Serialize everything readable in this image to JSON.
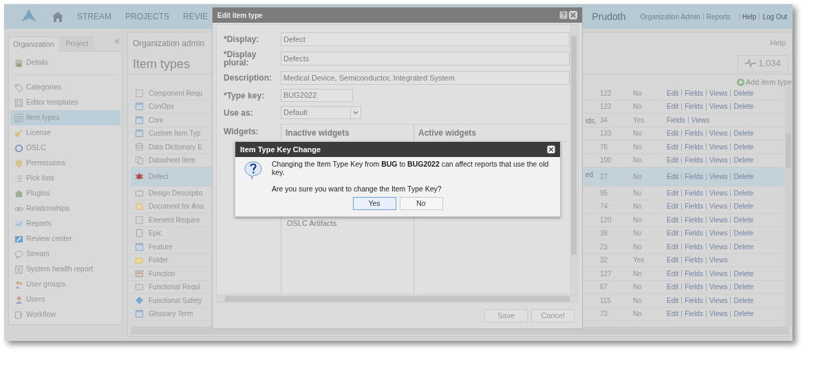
{
  "nav": {
    "items": [
      {
        "label": "STREAM"
      },
      {
        "label": "PROJECTS"
      },
      {
        "label": "REVIE"
      }
    ],
    "user": "Prudoth",
    "admin_links": [
      "Organization Admin",
      "Reports"
    ],
    "links": [
      "Help",
      "Log Out"
    ]
  },
  "sidebar": {
    "tabs": [
      {
        "label": "Organization",
        "selected": true
      },
      {
        "label": "Project",
        "selected": false
      }
    ],
    "collapse": "«",
    "items": [
      {
        "label": "Details",
        "selected": false
      },
      {
        "label": "Categories",
        "selected": false
      },
      {
        "label": "Editor templates",
        "selected": false
      },
      {
        "label": "Item types",
        "selected": true
      },
      {
        "label": "License",
        "selected": false
      },
      {
        "label": "OSLC",
        "selected": false
      },
      {
        "label": "Permissions",
        "selected": false
      },
      {
        "label": "Pick lists",
        "selected": false
      },
      {
        "label": "Plugins",
        "selected": false
      },
      {
        "label": "Relationships",
        "selected": false
      },
      {
        "label": "Reports",
        "selected": false
      },
      {
        "label": "Review center",
        "selected": false
      },
      {
        "label": "Stream",
        "selected": false
      },
      {
        "label": "System health report",
        "selected": false
      },
      {
        "label": "User groups",
        "selected": false
      },
      {
        "label": "Users",
        "selected": false
      },
      {
        "label": "Workflow",
        "selected": false
      }
    ]
  },
  "main": {
    "breadcrumb": "Organization admin",
    "help": "Help",
    "title": "Item types",
    "stat": "1,034",
    "add_link": "Add item type",
    "rows": [
      {
        "column_2": "Component Requ",
        "column_4": "122",
        "column_5": "No",
        "actions": [
          "Edit",
          "Fields",
          "Views",
          "Delete"
        ],
        "selected": false
      },
      {
        "column_2": "ConOps",
        "column_4": "123",
        "column_5": "No",
        "actions": [
          "Edit",
          "Fields",
          "Views",
          "Delete"
        ],
        "selected": false
      },
      {
        "column_2": "Core",
        "column_3": "ids,",
        "column_4": "34",
        "column_5": "Yes",
        "actions": [
          "Fields",
          "Views"
        ],
        "selected": false
      },
      {
        "column_2": "Custom Item Typ",
        "column_4": "133",
        "column_5": "No",
        "actions": [
          "Edit",
          "Fields",
          "Views",
          "Delete"
        ],
        "selected": false
      },
      {
        "column_2": "Data Dictionary E",
        "column_4": "76",
        "column_5": "No",
        "actions": [
          "Edit",
          "Fields",
          "Views",
          "Delete"
        ],
        "selected": false
      },
      {
        "column_2": "Datasheet Item",
        "column_4": "100",
        "column_5": "No",
        "actions": [
          "Edit",
          "Fields",
          "Views",
          "Delete"
        ],
        "selected": false
      },
      {
        "column_2": "Defect",
        "column_3": "ed",
        "column_4": "27",
        "column_5": "No",
        "actions": [
          "Edit",
          "Fields",
          "Views",
          "Delete"
        ],
        "selected": true
      },
      {
        "column_2": "Design Descriptio",
        "column_4": "95",
        "column_5": "No",
        "actions": [
          "Edit",
          "Fields",
          "Views",
          "Delete"
        ],
        "selected": false
      },
      {
        "column_2": "Document for Ana",
        "column_4": "74",
        "column_5": "No",
        "actions": [
          "Edit",
          "Fields",
          "Views",
          "Delete"
        ],
        "selected": false
      },
      {
        "column_2": "Element Require",
        "column_4": "120",
        "column_5": "No",
        "actions": [
          "Edit",
          "Fields",
          "Views",
          "Delete"
        ],
        "selected": false
      },
      {
        "column_2": "Epic",
        "column_4": "38",
        "column_5": "No",
        "actions": [
          "Edit",
          "Fields",
          "Views",
          "Delete"
        ],
        "selected": false
      },
      {
        "column_2": "Feature",
        "column_4": "23",
        "column_5": "No",
        "actions": [
          "Edit",
          "Fields",
          "Views",
          "Delete"
        ],
        "selected": false
      },
      {
        "column_2": "Folder",
        "column_4": "32",
        "column_5": "Yes",
        "actions": [
          "Edit",
          "Fields",
          "Views"
        ],
        "selected": false
      },
      {
        "column_2": "Function",
        "column_4": "127",
        "column_5": "No",
        "actions": [
          "Edit",
          "Fields",
          "Views",
          "Delete"
        ],
        "selected": false
      },
      {
        "column_2": "Functional Requi",
        "column_4": "67",
        "column_5": "No",
        "actions": [
          "Edit",
          "Fields",
          "Views",
          "Delete"
        ],
        "selected": false
      },
      {
        "column_2": "Functional Safety",
        "column_4": "115",
        "column_5": "No",
        "actions": [
          "Edit",
          "Fields",
          "Views",
          "Delete"
        ],
        "selected": false
      },
      {
        "column_2": "Glossary Term",
        "column_4": "73",
        "column_5": "No",
        "actions": [
          "Edit",
          "Fields",
          "Views",
          "Delete"
        ],
        "selected": false
      }
    ]
  },
  "edit_dialog": {
    "title": "Edit item type",
    "fields": [
      {
        "label": "*Display:",
        "value": "Defect",
        "kind": "text"
      },
      {
        "label": "*Display plural:",
        "value": "Defects",
        "kind": "text"
      },
      {
        "label": "Description:",
        "value": "Medical Device, Semiconductor, Integrated System",
        "kind": "text"
      },
      {
        "label": "*Type key:",
        "value": "BUG2022",
        "kind": "short"
      },
      {
        "label": "Use as:",
        "value": "Default",
        "kind": "select"
      }
    ],
    "widgets_label": "Widgets:",
    "inactive_heading": "Inactive widgets",
    "active_heading": "Active widgets",
    "inactive_widgets": [
      "OSLC Artifacts"
    ],
    "buttons": [
      "Save",
      "Cancel"
    ]
  },
  "confirm_dialog": {
    "title": "Item Type Key Change",
    "message": "Changing the Item Type Key from **BUG** to **BUG2022** can affect reports that use the old key.",
    "question": "Are you sure you want to change the Item Type Key?",
    "buttons": [
      {
        "label": "Yes",
        "focused": true
      },
      {
        "label": "No",
        "focused": false
      }
    ]
  }
}
